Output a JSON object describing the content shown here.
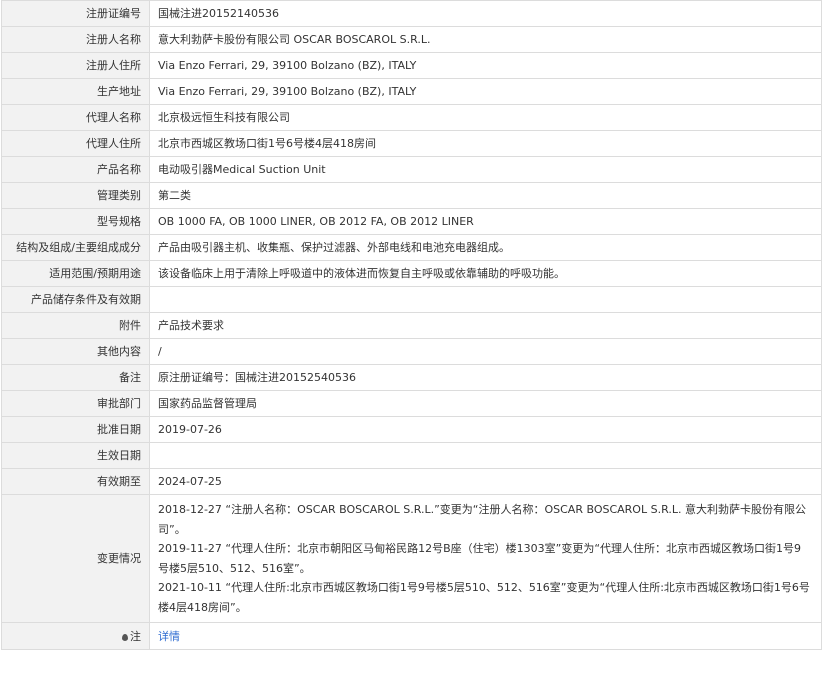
{
  "rows": [
    {
      "label": "注册证编号",
      "value": "国械注进20152140536"
    },
    {
      "label": "注册人名称",
      "value": "意大利勃萨卡股份有限公司 OSCAR BOSCAROL S.R.L."
    },
    {
      "label": "注册人住所",
      "value": "Via Enzo Ferrari, 29, 39100 Bolzano (BZ), ITALY"
    },
    {
      "label": "生产地址",
      "value": "Via Enzo Ferrari, 29, 39100 Bolzano (BZ), ITALY"
    },
    {
      "label": "代理人名称",
      "value": "北京极远恒生科技有限公司"
    },
    {
      "label": "代理人住所",
      "value": "北京市西城区教场口街1号6号楼4层418房间"
    },
    {
      "label": "产品名称",
      "value": "电动吸引器Medical Suction Unit"
    },
    {
      "label": "管理类别",
      "value": "第二类"
    },
    {
      "label": "型号规格",
      "value": "OB 1000 FA, OB 1000 LINER, OB 2012 FA, OB 2012 LINER"
    },
    {
      "label": "结构及组成/主要组成成分",
      "value": "产品由吸引器主机、收集瓶、保护过滤器、外部电线和电池充电器组成。"
    },
    {
      "label": "适用范围/预期用途",
      "value": "该设备临床上用于清除上呼吸道中的液体进而恢复自主呼吸或依靠辅助的呼吸功能。"
    },
    {
      "label": "产品储存条件及有效期",
      "value": ""
    },
    {
      "label": "附件",
      "value": "产品技术要求"
    },
    {
      "label": "其他内容",
      "value": "/"
    },
    {
      "label": "备注",
      "value": "原注册证编号：国械注进20152540536"
    },
    {
      "label": "审批部门",
      "value": "国家药品监督管理局"
    },
    {
      "label": "批准日期",
      "value": "2019-07-26"
    },
    {
      "label": "生效日期",
      "value": ""
    },
    {
      "label": "有效期至",
      "value": "2024-07-25"
    }
  ],
  "changes": {
    "label": "变更情况",
    "entries": [
      "2018-12-27 “注册人名称：OSCAR BOSCAROL S.R.L.”变更为“注册人名称：OSCAR BOSCAROL S.R.L. 意大利勃萨卡股份有限公司”。",
      "2019-11-27 “代理人住所：北京市朝阳区马甸裕民路12号B座（住宅）楼1303室”变更为“代理人住所：北京市西城区教场口街1号9号楼5层510、512、516室”。",
      "2021-10-11 “代理人住所:北京市西城区教场口街1号9号楼5层510、512、516室”变更为“代理人住所:北京市西城区教场口街1号6号楼4层418房间”。"
    ]
  },
  "note": {
    "label": "注",
    "link_text": "详情",
    "icon": "location-pin-icon"
  }
}
